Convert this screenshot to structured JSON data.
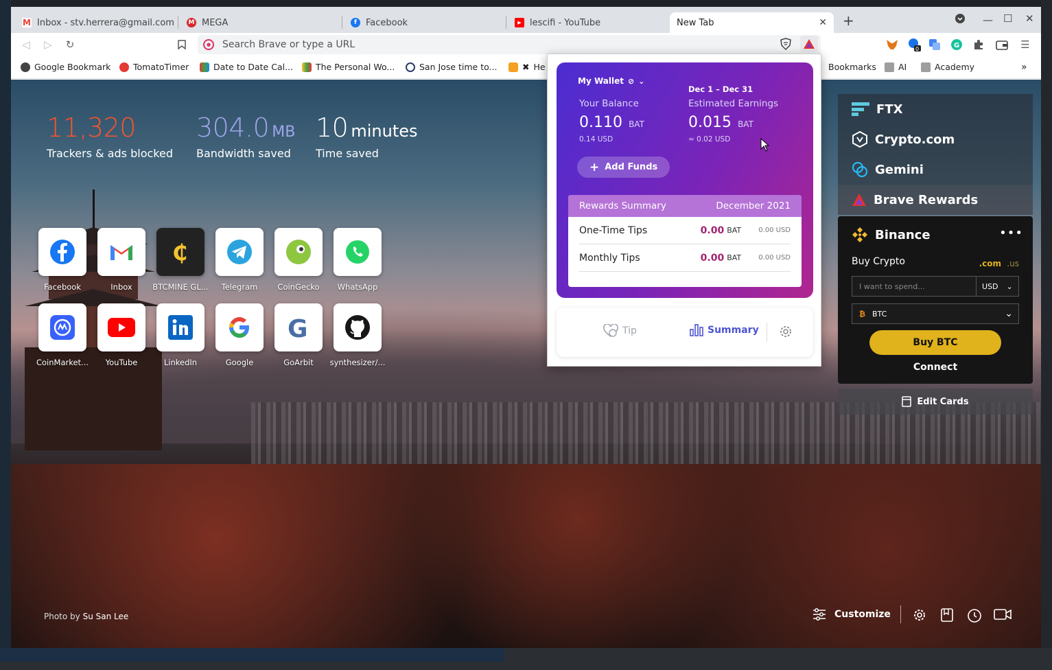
{
  "tabs": [
    {
      "title": "Inbox - stv.herrera@gmail.com - Gmail",
      "icon": "gmail-icon",
      "color": "#ea4335"
    },
    {
      "title": "MEGA",
      "icon": "mega-icon",
      "color": "#d9272e"
    },
    {
      "title": "Facebook",
      "icon": "facebook-icon",
      "color": "#1877f2"
    },
    {
      "title": "lescifi - YouTube",
      "icon": "youtube-icon",
      "color": "#ff0000"
    },
    {
      "title": "New Tab",
      "icon": "",
      "color": ""
    }
  ],
  "toolbar": {
    "omnibox_placeholder": "Search Brave or type a URL"
  },
  "bookmarks": [
    {
      "label": "Google Bookmark",
      "color": "#444"
    },
    {
      "label": "TomatoTimer",
      "color": "#e53935"
    },
    {
      "label": "Date to Date Cal...",
      "color": "#888"
    },
    {
      "label": "The Personal Wo...",
      "color": "#888"
    },
    {
      "label": "San Jose time to...",
      "color": "#2b3a67"
    },
    {
      "label": "He",
      "color": "#f4a020"
    },
    {
      "label": "Bookmarks",
      "color": "#9e9e9e"
    },
    {
      "label": "AI",
      "color": "#9e9e9e"
    },
    {
      "label": "Academy",
      "color": "#9e9e9e"
    }
  ],
  "stats": {
    "trackers_value": "11,320",
    "trackers_label": "Trackers & ads blocked",
    "bandwidth_value": "304.0",
    "bandwidth_unit": "MB",
    "bandwidth_label": "Bandwidth saved",
    "time_value": "10",
    "time_unit": "minutes",
    "time_label": "Time saved"
  },
  "top_sites": [
    {
      "name": "Facebook"
    },
    {
      "name": "Inbox"
    },
    {
      "name": "BTCMINE GL..."
    },
    {
      "name": "Telegram"
    },
    {
      "name": "CoinGecko"
    },
    {
      "name": "WhatsApp"
    },
    {
      "name": "CoinMarket..."
    },
    {
      "name": "YouTube"
    },
    {
      "name": "LinkedIn"
    },
    {
      "name": "Google"
    },
    {
      "name": "GoArbit"
    },
    {
      "name": "synthesizer/..."
    }
  ],
  "photo_credit": {
    "prefix": "Photo by",
    "author": "Su San Lee"
  },
  "customize_label": "Customize",
  "widgets": {
    "ftx": "FTX",
    "crypto_com": "Crypto.com",
    "gemini": "Gemini",
    "brave_rewards": "Brave Rewards",
    "binance": {
      "title": "Binance",
      "buy_crypto": "Buy Crypto",
      "domain_com": ".com",
      "domain_us": ".us",
      "spend_placeholder": "I want to spend...",
      "currency": "USD",
      "asset": "BTC",
      "buy_button": "Buy BTC",
      "connect": "Connect"
    },
    "edit_cards": "Edit Cards"
  },
  "rewards": {
    "wallet_label": "My Wallet",
    "date_range": "Dec 1 – Dec 31",
    "balance_label": "Your Balance",
    "balance_value": "0.110",
    "balance_unit": "BAT",
    "balance_usd": "0.14 USD",
    "earnings_label": "Estimated Earnings",
    "earnings_value": "0.015",
    "earnings_unit": "BAT",
    "earnings_usd": "≈ 0.02 USD",
    "add_funds": "Add Funds",
    "summary_title": "Rewards Summary",
    "summary_month": "December 2021",
    "rows": [
      {
        "label": "One-Time Tips",
        "value": "0.00",
        "unit": "BAT",
        "usd": "0.00 USD"
      },
      {
        "label": "Monthly Tips",
        "value": "0.00",
        "unit": "BAT",
        "usd": "0.00 USD"
      }
    ],
    "tab_tip": "Tip",
    "tab_summary": "Summary"
  },
  "colors": {
    "brave_orange": "#fb542b",
    "accent_purple": "#4c54d2",
    "binance_yellow": "#e0b21b",
    "bat_magenta": "#a1236f"
  }
}
